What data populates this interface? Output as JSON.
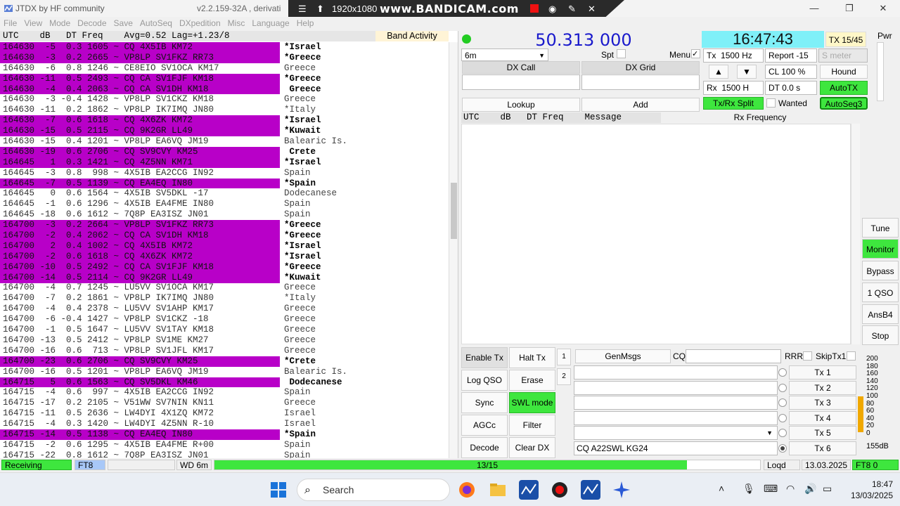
{
  "window": {
    "title": "JTDX   by HF community",
    "version": "v2.2.159-32A , derivati",
    "minimize": "—",
    "maximize": "❐",
    "close": "✕"
  },
  "bandicam": {
    "resolution": "1920x1080",
    "brand": "www.BANDICAM.com"
  },
  "menu": [
    "File",
    "View",
    "Mode",
    "Decode",
    "Save",
    "AutoSeq",
    "DXpedition",
    "Misc",
    "Language",
    "Help"
  ],
  "band_activity": {
    "header": "UTC    dB   DT Freq    Avg=0.52 Lag=+1.23/8",
    "title": "Band Activity",
    "rows": [
      {
        "text": "164630  -5  0.3 1605 ~ CQ 4X5IB KM72",
        "country": "*Israel",
        "cq": true
      },
      {
        "text": "164630  -3  0.2 2665 ~ VP8LP SV1FKZ RR73",
        "country": "*Greece",
        "cq": true
      },
      {
        "text": "164630  -6  0.8 1246 ~ CE8EIO SV1OCA KM17",
        "country": "Greece",
        "cq": false
      },
      {
        "text": "164630 -11  0.5 2493 ~ CQ CA SV1FJF KM18",
        "country": "*Greece",
        "cq": true
      },
      {
        "text": "164630  -4  0.4 2063 ~ CQ CA SV1DH KM18",
        "country": " Greece",
        "cq": true
      },
      {
        "text": "164630  -3 -0.4 1428 ~ VP8LP SV1CKZ KM18",
        "country": "Greece",
        "cq": false
      },
      {
        "text": "164630 -11  0.2 1862 ~ VP8LP IK7IMQ JN80",
        "country": "*Italy",
        "cq": false
      },
      {
        "text": "164630  -7  0.6 1618 ~ CQ 4X6ZK KM72",
        "country": "*Israel",
        "cq": true
      },
      {
        "text": "164630 -15  0.5 2115 ~ CQ 9K2GR LL49",
        "country": "*Kuwait",
        "cq": true
      },
      {
        "text": "164630 -15  0.4 1201 ~ VP8LP EA6VQ JM19",
        "country": "Balearic Is.",
        "cq": false
      },
      {
        "text": "164630 -19  0.6 2706 ~ CQ SV9CVY KM25",
        "country": " Crete",
        "cq": true
      },
      {
        "text": "164645   1  0.3 1421 ~ CQ 4Z5NN KM71",
        "country": "*Israel",
        "cq": true
      },
      {
        "text": "164645  -3  0.8  998 ~ 4X5IB EA2CCG IN92",
        "country": "Spain",
        "cq": false
      },
      {
        "text": "164645  -7  0.5 1139 ~ CQ EA4EQ IN80",
        "country": "*Spain",
        "cq": true
      },
      {
        "text": "164645   0  0.6 1564 ~ 4X5IB SV5DKL -17",
        "country": "Dodecanese",
        "cq": false
      },
      {
        "text": "164645  -1  0.6 1296 ~ 4X5IB EA4FME IN80",
        "country": "Spain",
        "cq": false
      },
      {
        "text": "164645 -18  0.6 1612 ~ 7Q8P EA3ISZ JN01",
        "country": "Spain",
        "cq": false
      },
      {
        "text": "164700  -3  0.2 2664 ~ VP8LP SV1FKZ RR73",
        "country": "*Greece",
        "cq": true
      },
      {
        "text": "164700  -2  0.4 2062 ~ CQ CA SV1DH KM18",
        "country": "*Greece",
        "cq": true
      },
      {
        "text": "164700   2  0.4 1002 ~ CQ 4X5IB KM72",
        "country": "*Israel",
        "cq": true
      },
      {
        "text": "164700  -2  0.6 1618 ~ CQ 4X6ZK KM72",
        "country": "*Israel",
        "cq": true
      },
      {
        "text": "164700 -10  0.5 2492 ~ CQ CA SV1FJF KM18",
        "country": "*Greece",
        "cq": true
      },
      {
        "text": "164700 -14  0.5 2114 ~ CQ 9K2GR LL49",
        "country": "*Kuwait",
        "cq": true
      },
      {
        "text": "164700  -4  0.7 1245 ~ LU5VV SV1OCA KM17",
        "country": "Greece",
        "cq": false
      },
      {
        "text": "164700  -7  0.2 1861 ~ VP8LP IK7IMQ JN80",
        "country": "*Italy",
        "cq": false
      },
      {
        "text": "164700  -4  0.4 2378 ~ LU5VV SV1AHP KM17",
        "country": "Greece",
        "cq": false
      },
      {
        "text": "164700  -6 -0.4 1427 ~ VP8LP SV1CKZ -18",
        "country": "Greece",
        "cq": false
      },
      {
        "text": "164700  -1  0.5 1647 ~ LU5VV SV1TAY KM18",
        "country": "Greece",
        "cq": false
      },
      {
        "text": "164700 -13  0.5 2412 ~ VP8LP SV1ME KM27",
        "country": "Greece",
        "cq": false
      },
      {
        "text": "164700 -16  0.6  713 ~ VP8LP SV1JFL KM17",
        "country": "Greece",
        "cq": false
      },
      {
        "text": "164700 -23  0.6 2706 ~ CQ SV9CVY KM25",
        "country": "*Crete",
        "cq": true
      },
      {
        "text": "164700 -16  0.5 1201 ~ VP8LP EA6VQ JM19",
        "country": "Balearic Is.",
        "cq": false
      },
      {
        "text": "164715   5  0.6 1563 ~ CQ SV5DKL KM46",
        "country": " Dodecanese",
        "cq": true
      },
      {
        "text": "164715  -4  0.6  997 ~ 4X5IB EA2CCG IN92",
        "country": "Spain",
        "cq": false
      },
      {
        "text": "164715 -17  0.2 2105 ~ V51WW SV7NIN KN11",
        "country": "Greece",
        "cq": false
      },
      {
        "text": "164715 -11  0.5 2636 ~ LW4DYI 4X1ZQ KM72",
        "country": "Israel",
        "cq": false
      },
      {
        "text": "164715  -4  0.3 1420 ~ LW4DYI 4Z5NN R-10",
        "country": "Israel",
        "cq": false
      },
      {
        "text": "164715 -14  0.5 1138 ~ CQ EA4EQ IN80",
        "country": "*Spain",
        "cq": true
      },
      {
        "text": "164715  -2  0.6 1295 ~ 4X5IB EA4FME R+00",
        "country": "Spain",
        "cq": false
      },
      {
        "text": "164715 -22  0.8 1612 ~ 7Q8P EA3ISZ JN01",
        "country": "Spain",
        "cq": false
      }
    ]
  },
  "controls": {
    "frequency": "50.313 000",
    "clock": "16:47:43",
    "tx_count": "TX 15/45",
    "band": "6m",
    "spt_label": "Spt",
    "menu_label": "Menu",
    "menu_check": "✓",
    "tx_label": "Tx",
    "tx_hz": "1500",
    "hz_unit": "Hz",
    "report": "Report -15",
    "s_meter": "S meter",
    "cl": "CL  100 %",
    "hound": "Hound",
    "rx_label": "Rx",
    "rx_hz": "1500",
    "rx_unit": "H",
    "dt": "DT 0.0 s",
    "autotx": "AutoTX",
    "split": "Tx/Rx Split",
    "wanted": "Wanted",
    "autoseq3": "AutoSeq3",
    "dx_call": "DX Call",
    "dx_grid": "DX Grid",
    "lookup": "Lookup",
    "add": "Add",
    "up": "▲",
    "down": "▼",
    "pwr": "Pwr"
  },
  "rx_frequency": {
    "header": "UTC    dB   DT Freq    Message",
    "title": "Rx Frequency"
  },
  "mode_buttons": [
    "Tune",
    "Monitor",
    "Bypass",
    "1 QSO",
    "AnsB4",
    "Stop"
  ],
  "bottom_buttons": {
    "enable_tx": "Enable Tx",
    "halt_tx": "Halt Tx",
    "log_qso": "Log QSO",
    "erase": "Erase",
    "sync": "Sync",
    "swl_mode": "SWL mode",
    "agcc": "AGCc",
    "filter": "Filter",
    "decode": "Decode",
    "clear_dx": "Clear DX"
  },
  "tx_panel": {
    "tab1": "1",
    "tab2": "2",
    "genmsgs": "GenMsgs",
    "cq": "CQ",
    "rrr": "RRR",
    "skiptx1": "SkipTx1",
    "tx_buttons": [
      "Tx 1",
      "Tx 2",
      "Tx 3",
      "Tx 4",
      "Tx 5",
      "Tx 6"
    ],
    "tx6_message": "CQ A22SWL KG24"
  },
  "meter": {
    "ticks": [
      "200",
      "180",
      "160",
      "140",
      "120",
      "100",
      "80",
      "60",
      "40",
      "20",
      "0"
    ],
    "label": "155dB",
    "level": 0.48
  },
  "status": {
    "receiving": "Receiving",
    "mode": "FT8",
    "wd": "WD 6m",
    "progress": "13/15",
    "progress_value": 0.866,
    "logd": "Loqd",
    "date": "13.03.2025",
    "ft8_count": "FT8  0"
  },
  "taskbar": {
    "search": "Search",
    "time": "18:47",
    "date": "13/03/2025"
  },
  "colors": {
    "cq_highlight": "#b800c8",
    "green": "#3ee63e",
    "freq_blue": "#1a1acc",
    "clock_cyan": "#7ff0f8"
  }
}
